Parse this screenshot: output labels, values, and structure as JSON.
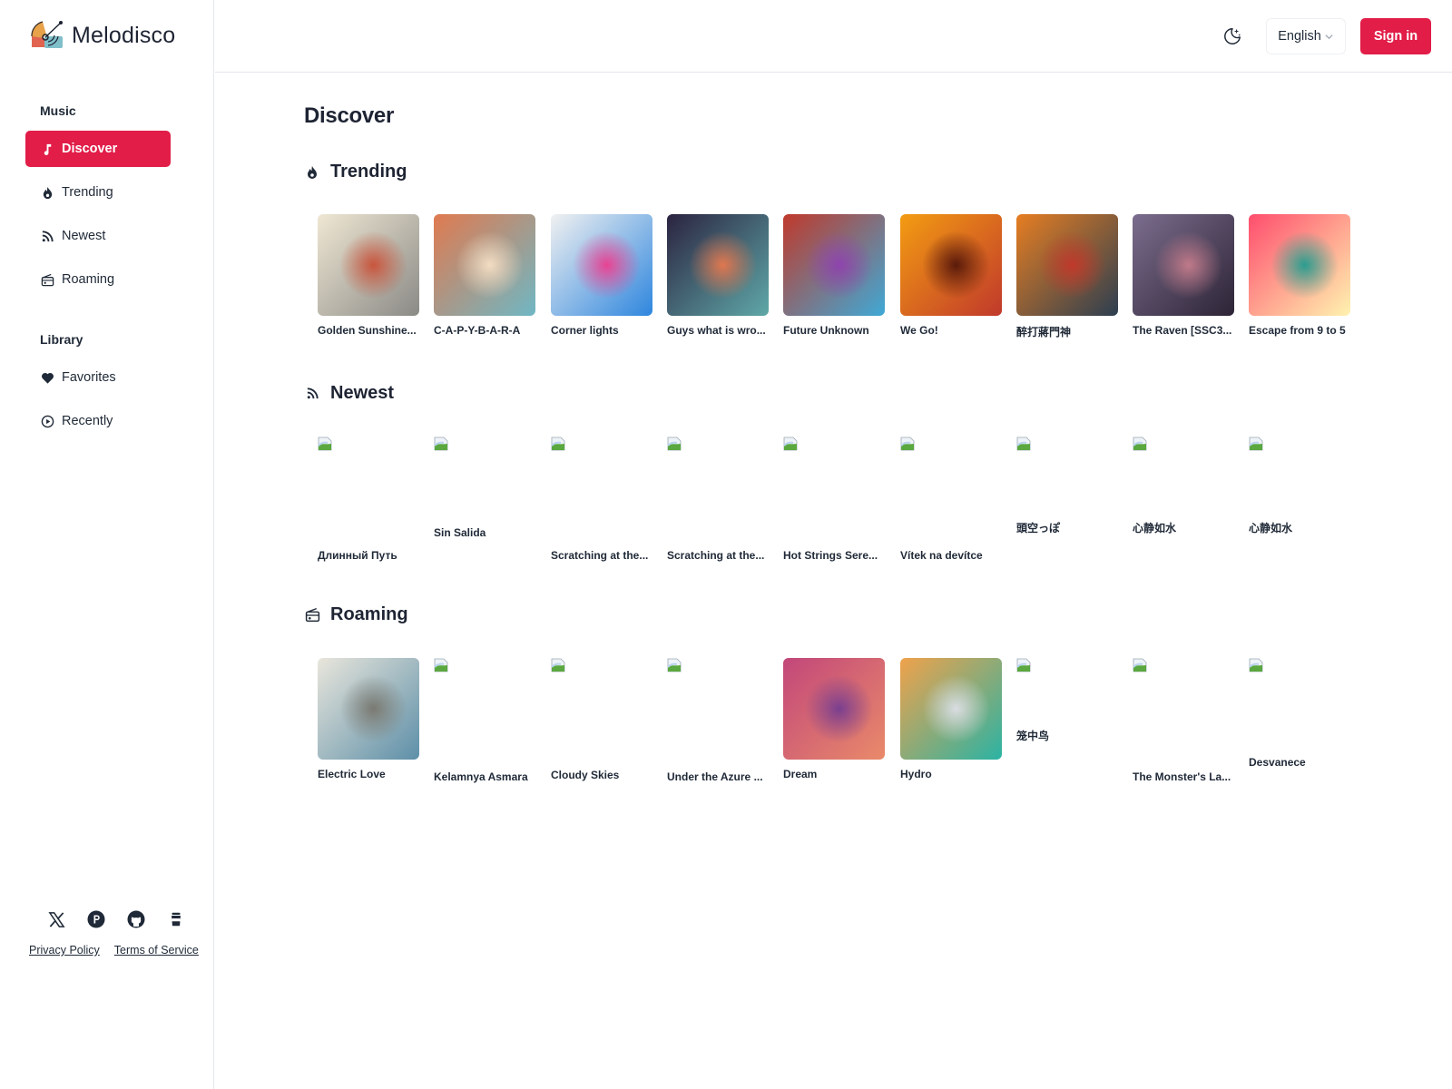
{
  "app": {
    "name": "Melodisco",
    "accent_color": "#e11d48"
  },
  "header": {
    "theme_toggle_icon": "moon-stars-icon",
    "language": "English",
    "sign_in_label": "Sign in"
  },
  "sidebar": {
    "groups": [
      {
        "title": "Music",
        "items": [
          {
            "label": "Discover",
            "icon": "music-note-icon",
            "active": true
          },
          {
            "label": "Trending",
            "icon": "flame-icon",
            "active": false
          },
          {
            "label": "Newest",
            "icon": "rss-icon",
            "active": false
          },
          {
            "label": "Roaming",
            "icon": "radio-icon",
            "active": false
          }
        ]
      },
      {
        "title": "Library",
        "items": [
          {
            "label": "Favorites",
            "icon": "heart-icon",
            "active": false
          },
          {
            "label": "Recently",
            "icon": "play-circle-icon",
            "active": false
          }
        ]
      }
    ],
    "social": [
      "x-icon",
      "product-hunt-icon",
      "github-icon",
      "coffee-cup-icon"
    ],
    "footer_links": [
      "Privacy Policy",
      "Terms of Service"
    ]
  },
  "main": {
    "title": "Discover",
    "sections": [
      {
        "title": "Trending",
        "icon": "flame-icon",
        "items": [
          {
            "title": "Golden Sunshine...",
            "cover": "loaded",
            "colors": [
              "#efe7d3",
              "#8a8a86",
              "#c8553d"
            ]
          },
          {
            "title": "C-A-P-Y-B-A-R-A",
            "cover": "loaded",
            "colors": [
              "#e07a4f",
              "#6fb7c4",
              "#f3dcc2"
            ]
          },
          {
            "title": "Corner lights",
            "cover": "loaded",
            "colors": [
              "#f1f1f1",
              "#2e86de",
              "#e84393"
            ]
          },
          {
            "title": "Guys what is wro...",
            "cover": "loaded",
            "colors": [
              "#2b2340",
              "#5fa8a8",
              "#e0774f"
            ]
          },
          {
            "title": "Future Unknown",
            "cover": "loaded",
            "colors": [
              "#c0392b",
              "#3fa9d6",
              "#8e44ad"
            ]
          },
          {
            "title": "We Go!",
            "cover": "loaded",
            "colors": [
              "#f39c12",
              "#c0392b",
              "#5a1a0a"
            ]
          },
          {
            "title": "醉打蔣門神",
            "cover": "loaded",
            "colors": [
              "#e67e22",
              "#2c3e50",
              "#c0392b"
            ]
          },
          {
            "title": "The Raven [SSC3...",
            "cover": "loaded",
            "colors": [
              "#7b6d8d",
              "#2d2436",
              "#c07a8a"
            ]
          },
          {
            "title": "Escape from 9 to 5",
            "cover": "loaded",
            "colors": [
              "#ff4d6d",
              "#fff3b0",
              "#2a9d8f"
            ]
          }
        ]
      },
      {
        "title": "Newest",
        "icon": "rss-icon",
        "items": [
          {
            "title": "Длинный Путь",
            "cover": "broken"
          },
          {
            "title": "Sin Salida",
            "cover": "broken"
          },
          {
            "title": "Scratching at the...",
            "cover": "broken"
          },
          {
            "title": "Scratching at the...",
            "cover": "broken"
          },
          {
            "title": "Hot Strings Sere...",
            "cover": "broken"
          },
          {
            "title": "Vítek na devítce",
            "cover": "broken"
          },
          {
            "title": "頭空っぽ",
            "cover": "broken"
          },
          {
            "title": "心静如水",
            "cover": "broken"
          },
          {
            "title": "心静如水",
            "cover": "broken"
          }
        ]
      },
      {
        "title": "Roaming",
        "icon": "radio-icon",
        "items": [
          {
            "title": "Electric Love",
            "cover": "loaded",
            "colors": [
              "#e9e6dc",
              "#5d8fa8",
              "#7a7a72"
            ]
          },
          {
            "title": "Kelamnya Asmara",
            "cover": "broken"
          },
          {
            "title": "Cloudy Skies",
            "cover": "broken"
          },
          {
            "title": "Under the Azure ...",
            "cover": "broken"
          },
          {
            "title": "Dream",
            "cover": "loaded",
            "colors": [
              "#c2477a",
              "#e98a6a",
              "#7a3f8f"
            ]
          },
          {
            "title": "Hydro",
            "cover": "loaded",
            "colors": [
              "#f0a24b",
              "#2bb3a3",
              "#d9dde2"
            ]
          },
          {
            "title": "笼中鸟",
            "cover": "broken"
          },
          {
            "title": "The Monster's La...",
            "cover": "broken"
          },
          {
            "title": "Desvanece",
            "cover": "broken"
          }
        ]
      }
    ]
  }
}
